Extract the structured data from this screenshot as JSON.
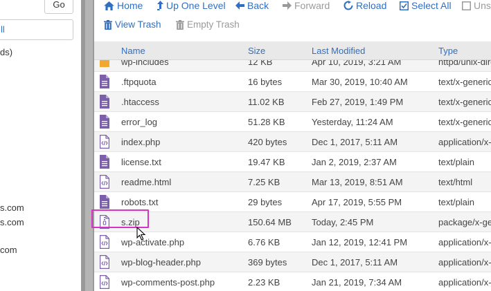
{
  "left": {
    "go_label": "Go",
    "field_text": "ll",
    "text_1": "ds)",
    "text_2": "s.com",
    "text_3": "s.com",
    "text_4": "com"
  },
  "toolbar": {
    "home": "Home",
    "up_one_level": "Up One Level",
    "back": "Back",
    "forward": "Forward",
    "reload": "Reload",
    "select_all": "Select All",
    "unselect": "Uns",
    "view_trash": "View Trash",
    "empty_trash": "Empty Trash"
  },
  "columns": {
    "name": "Name",
    "size": "Size",
    "last_modified": "Last Modified",
    "type": "Type"
  },
  "files": [
    {
      "icon": "folder-icon",
      "name": "wp-includes",
      "size": "12 KB",
      "modified": "Apr 10, 2019, 3:21 AM",
      "type": "httpd/unix-dire"
    },
    {
      "icon": "text-file-icon",
      "name": ".ftpquota",
      "size": "16 bytes",
      "modified": "Mar 30, 2019, 10:40 AM",
      "type": "text/x-generic"
    },
    {
      "icon": "text-file-icon",
      "name": ".htaccess",
      "size": "11.02 KB",
      "modified": "Feb 27, 2019, 1:49 PM",
      "type": "text/x-generic"
    },
    {
      "icon": "text-file-icon",
      "name": "error_log",
      "size": "51.28 KB",
      "modified": "Yesterday, 11:24 AM",
      "type": "text/x-generic"
    },
    {
      "icon": "code-file-icon",
      "name": "index.php",
      "size": "420 bytes",
      "modified": "Dec 1, 2017, 5:11 AM",
      "type": "application/x-"
    },
    {
      "icon": "text-file-icon",
      "name": "license.txt",
      "size": "19.47 KB",
      "modified": "Jan 2, 2019, 2:37 AM",
      "type": "text/plain"
    },
    {
      "icon": "code-file-icon",
      "name": "readme.html",
      "size": "7.25 KB",
      "modified": "Mar 13, 2019, 8:51 AM",
      "type": "text/html"
    },
    {
      "icon": "text-file-icon",
      "name": "robots.txt",
      "size": "29 bytes",
      "modified": "Apr 17, 2019, 5:55 PM",
      "type": "text/plain"
    },
    {
      "icon": "zip-file-icon",
      "name": "s.zip",
      "size": "150.64 MB",
      "modified": "Today, 2:45 PM",
      "type": "package/x-ge"
    },
    {
      "icon": "code-file-icon",
      "name": "wp-activate.php",
      "size": "6.76 KB",
      "modified": "Jan 12, 2019, 12:41 PM",
      "type": "application/x-"
    },
    {
      "icon": "code-file-icon",
      "name": "wp-blog-header.php",
      "size": "369 bytes",
      "modified": "Dec 1, 2017, 5:11 AM",
      "type": "application/x-"
    },
    {
      "icon": "code-file-icon",
      "name": "wp-comments-post.php",
      "size": "2.23 KB",
      "modified": "Jan 21, 2019, 7:34 AM",
      "type": "application/x-"
    }
  ],
  "colors": {
    "link": "#2f6fc2",
    "file_icon": "#7b5fa8",
    "folder_icon": "#f0a830",
    "highlight": "#d633c5"
  }
}
